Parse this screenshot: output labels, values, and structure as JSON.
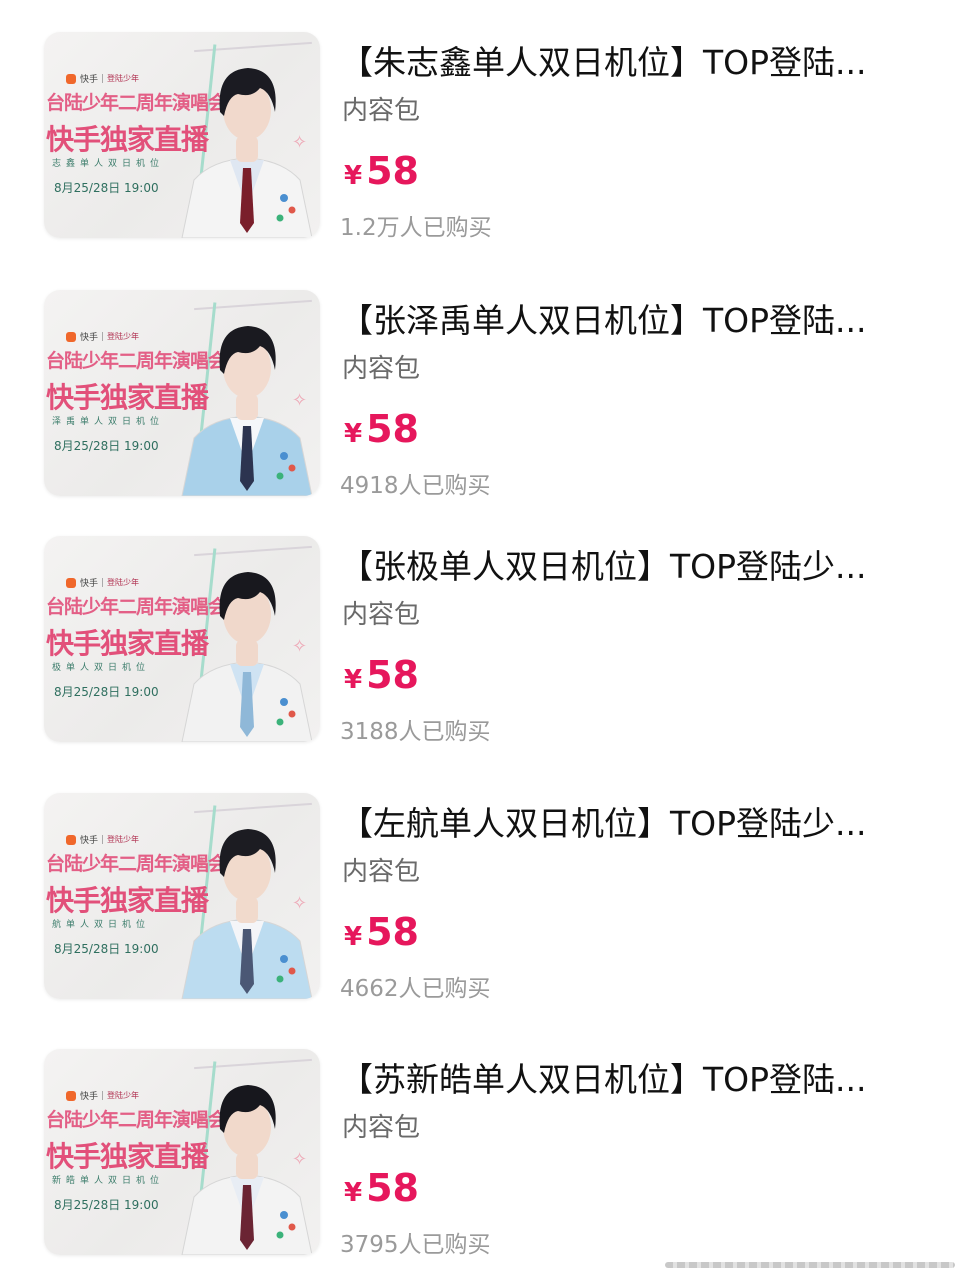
{
  "products": [
    {
      "title": "【朱志鑫单人双日机位】TOP登陆...",
      "tag": "内容包",
      "currency": "¥",
      "price": "58",
      "sold": "1.2万人已购买",
      "thumb": {
        "brand": "快手",
        "brand2": "登陆少年",
        "line1": "台陆少年二周年演唱会",
        "line2": "快手独家直播",
        "line3": "志鑫单人双日机位",
        "date": "8月25/28日 19:00"
      }
    },
    {
      "title": "【张泽禹单人双日机位】TOP登陆...",
      "tag": "内容包",
      "currency": "¥",
      "price": "58",
      "sold": "4918人已购买",
      "thumb": {
        "brand": "快手",
        "brand2": "登陆少年",
        "line1": "台陆少年二周年演唱会",
        "line2": "快手独家直播",
        "line3": "泽禹单人双日机位",
        "date": "8月25/28日 19:00"
      }
    },
    {
      "title": "【张极单人双日机位】TOP登陆少...",
      "tag": "内容包",
      "currency": "¥",
      "price": "58",
      "sold": "3188人已购买",
      "thumb": {
        "brand": "快手",
        "brand2": "登陆少年",
        "line1": "台陆少年二周年演唱会",
        "line2": "快手独家直播",
        "line3": "极单人双日机位",
        "date": "8月25/28日 19:00"
      }
    },
    {
      "title": "【左航单人双日机位】TOP登陆少...",
      "tag": "内容包",
      "currency": "¥",
      "price": "58",
      "sold": "4662人已购买",
      "thumb": {
        "brand": "快手",
        "brand2": "登陆少年",
        "line1": "台陆少年二周年演唱会",
        "line2": "快手独家直播",
        "line3": "航单人双日机位",
        "date": "8月25/28日 19:00"
      }
    },
    {
      "title": "【苏新皓单人双日机位】TOP登陆...",
      "tag": "内容包",
      "currency": "¥",
      "price": "58",
      "sold": "3795人已购买",
      "thumb": {
        "brand": "快手",
        "brand2": "登陆少年",
        "line1": "台陆少年二周年演唱会",
        "line2": "快手独家直播",
        "line3": "新皓单人双日机位",
        "date": "8月25/28日 19:00"
      }
    }
  ],
  "colors": {
    "price": "#e6175c",
    "thumb_pink": "#e2507a",
    "thumb_green": "#3d7d6c",
    "muted": "#9a9a9a"
  },
  "icons": [
    "kuaishou-logo-icon",
    "star-doodle-icon",
    "home-indicator"
  ]
}
